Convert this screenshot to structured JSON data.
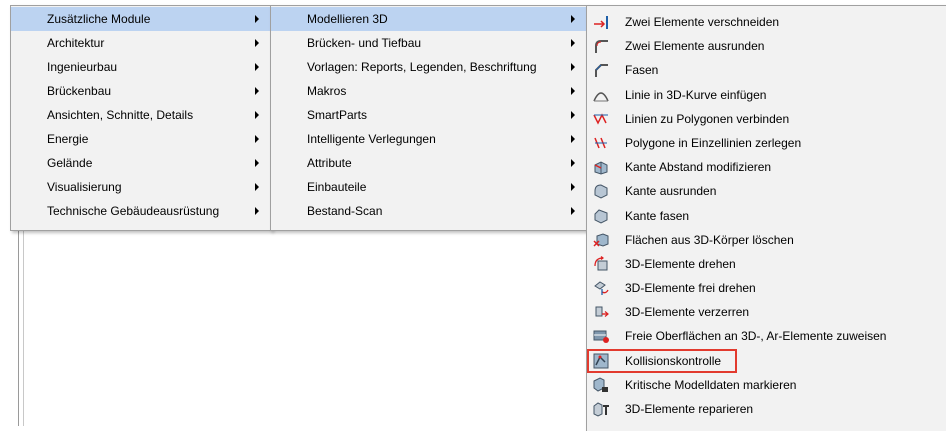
{
  "menu_level1": {
    "items": [
      {
        "label": "Zusätzliche Module",
        "highlighted": true
      },
      {
        "label": "Architektur"
      },
      {
        "label": "Ingenieurbau"
      },
      {
        "label": "Brückenbau"
      },
      {
        "label": "Ansichten, Schnitte, Details"
      },
      {
        "label": "Energie"
      },
      {
        "label": "Gelände"
      },
      {
        "label": "Visualisierung"
      },
      {
        "label": "Technische Gebäudeausrüstung"
      }
    ]
  },
  "menu_level2": {
    "items": [
      {
        "label": "Modellieren 3D",
        "highlighted": true
      },
      {
        "label": "Brücken- und Tiefbau"
      },
      {
        "label": "Vorlagen: Reports, Legenden, Beschriftung"
      },
      {
        "label": "Makros"
      },
      {
        "label": "SmartParts"
      },
      {
        "label": "Intelligente Verlegungen"
      },
      {
        "label": "Attribute"
      },
      {
        "label": "Einbauteile"
      },
      {
        "label": "Bestand-Scan"
      }
    ]
  },
  "menu_level3": {
    "items": [
      {
        "label": "Zwei Elemente verschneiden",
        "icon": "intersect-elements-icon"
      },
      {
        "label": "Zwei Elemente ausrunden",
        "icon": "fillet-elements-icon"
      },
      {
        "label": "Fasen",
        "icon": "chamfer-icon"
      },
      {
        "label": "Linie in 3D-Kurve einfügen",
        "icon": "insert-3d-curve-icon"
      },
      {
        "label": "Linien zu Polygonen verbinden",
        "icon": "join-polygon-icon"
      },
      {
        "label": "Polygone in Einzellinien zerlegen",
        "icon": "explode-polygon-icon"
      },
      {
        "label": "Kante Abstand modifizieren",
        "icon": "edge-offset-icon"
      },
      {
        "label": "Kante ausrunden",
        "icon": "edge-fillet-icon"
      },
      {
        "label": "Kante fasen",
        "icon": "edge-chamfer-icon"
      },
      {
        "label": "Flächen aus 3D-Körper löschen",
        "icon": "delete-faces-icon"
      },
      {
        "label": "3D-Elemente drehen",
        "icon": "rotate-3d-icon"
      },
      {
        "label": "3D-Elemente frei drehen",
        "icon": "free-rotate-3d-icon"
      },
      {
        "label": "3D-Elemente verzerren",
        "icon": "distort-3d-icon"
      },
      {
        "label": "Freie Oberflächen an 3D-, Ar-Elemente zuweisen",
        "icon": "assign-surface-icon"
      },
      {
        "label": "Kollisionskontrolle",
        "icon": "collision-check-icon",
        "outlined": true
      },
      {
        "label": "Kritische Modelldaten markieren",
        "icon": "mark-critical-data-icon"
      },
      {
        "label": "3D-Elemente reparieren",
        "icon": "repair-3d-icon"
      }
    ]
  },
  "colors": {
    "menu_bg": "#f2f2f2",
    "highlight": "#bcd3f1",
    "callout_outline": "#e23a2e"
  }
}
